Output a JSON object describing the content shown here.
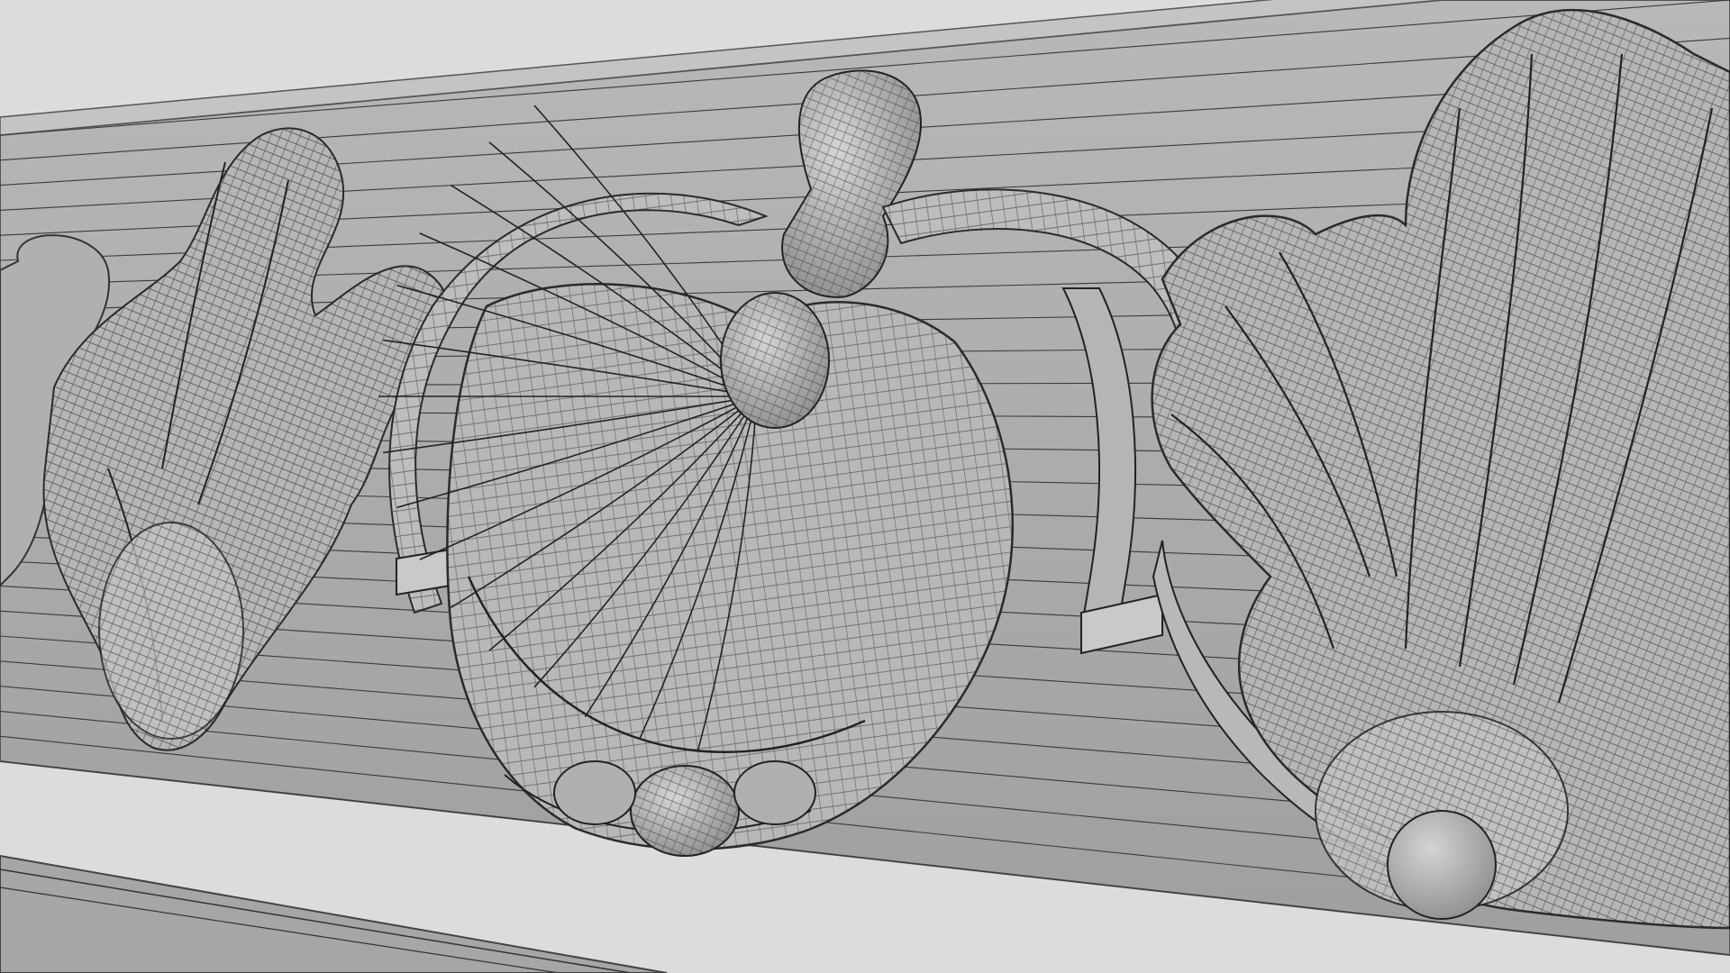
{
  "viewport": {
    "background_color": "#dcdcdc",
    "frieze_face_color": "#a9a9a9",
    "frieze_top_color": "#c4c4c4",
    "ornament_fill_color": "#b3b3b3",
    "ornament_highlight_color": "#cfcfcf",
    "wireframe_color": "#2e2e2e"
  },
  "scene": {
    "subject": "wireframe-mesh-ornamental-frieze",
    "ornaments": [
      "acanthus-leaf-cluster-left",
      "scroll-ring-left",
      "shell-medallion-center",
      "finial-bulb-top",
      "scroll-ring-right",
      "acanthus-leaf-cluster-right"
    ],
    "lower_molding": "partial-molding-bottom-left"
  }
}
